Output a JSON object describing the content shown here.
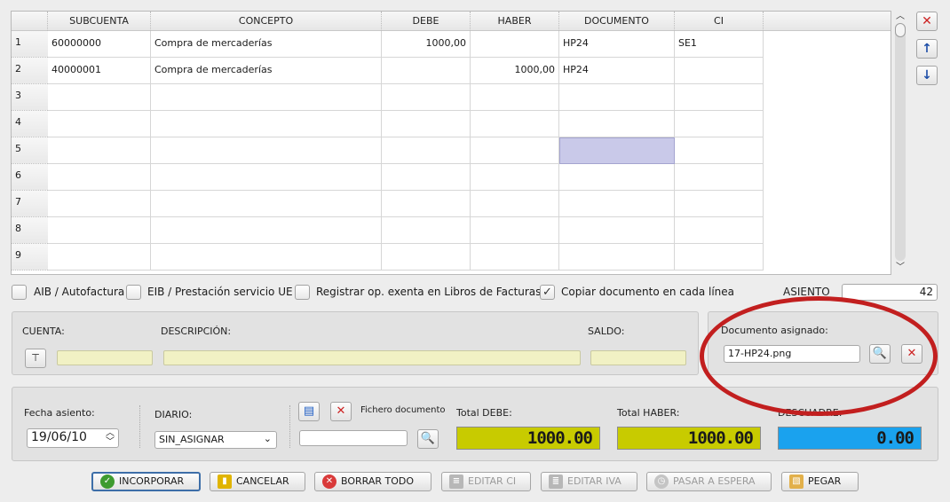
{
  "grid": {
    "columns": [
      "SUBCUENTA",
      "CONCEPTO",
      "DEBE",
      "HABER",
      "DOCUMENTO",
      "CI"
    ],
    "rows": [
      {
        "num": "1",
        "subcuenta": "60000000",
        "concepto": "Compra de mercaderías",
        "debe": "1000,00",
        "haber": "",
        "documento": "HP24",
        "ci": "SE1"
      },
      {
        "num": "2",
        "subcuenta": "40000001",
        "concepto": "Compra de mercaderías",
        "debe": "",
        "haber": "1000,00",
        "documento": "HP24",
        "ci": ""
      },
      {
        "num": "3",
        "subcuenta": "",
        "concepto": "",
        "debe": "",
        "haber": "",
        "documento": "",
        "ci": ""
      },
      {
        "num": "4",
        "subcuenta": "",
        "concepto": "",
        "debe": "",
        "haber": "",
        "documento": "",
        "ci": ""
      },
      {
        "num": "5",
        "subcuenta": "",
        "concepto": "",
        "debe": "",
        "haber": "",
        "documento": "",
        "ci": ""
      },
      {
        "num": "6",
        "subcuenta": "",
        "concepto": "",
        "debe": "",
        "haber": "",
        "documento": "",
        "ci": ""
      },
      {
        "num": "7",
        "subcuenta": "",
        "concepto": "",
        "debe": "",
        "haber": "",
        "documento": "",
        "ci": ""
      },
      {
        "num": "8",
        "subcuenta": "",
        "concepto": "",
        "debe": "",
        "haber": "",
        "documento": "",
        "ci": ""
      },
      {
        "num": "9",
        "subcuenta": "",
        "concepto": "",
        "debe": "",
        "haber": "",
        "documento": "",
        "ci": ""
      }
    ],
    "selected_cell": {
      "row": 5,
      "column": "DOCUMENTO"
    }
  },
  "side_buttons": [
    {
      "name": "delete-row",
      "icon": "close-icon",
      "glyph": "✕",
      "color": "#cc2222"
    },
    {
      "name": "move-up",
      "icon": "arrow-up-icon",
      "glyph": "↑",
      "color": "#1f4fa8"
    },
    {
      "name": "move-down",
      "icon": "arrow-down-icon",
      "glyph": "↓",
      "color": "#1f4fa8"
    }
  ],
  "options": {
    "aib": {
      "label": "AIB / Autofactura",
      "checked": false
    },
    "eib": {
      "label": "EIB / Prestación servicio UE",
      "checked": false
    },
    "exenta": {
      "label": "Registrar op. exenta en Libros de Facturas",
      "checked": false
    },
    "copiar": {
      "label": "Copiar documento en cada línea",
      "checked": true
    }
  },
  "asiento": {
    "label": "ASIENTO",
    "value": "42"
  },
  "account": {
    "cuenta_label": "CUENTA:",
    "descripcion_label": "DESCRIPCIÓN:",
    "saldo_label": "SALDO:"
  },
  "documento": {
    "label": "Documento asignado:",
    "value": "17-HP24.png"
  },
  "footer": {
    "fecha_label": "Fecha asiento:",
    "fecha_value": "19/06/10",
    "diario_label": "DIARIO:",
    "diario_value": "SIN_ASIGNAR",
    "fichero_label": "Fichero documento",
    "total_debe_label": "Total DEBE:",
    "total_debe_value": "1000.00",
    "total_haber_label": "Total HABER:",
    "total_haber_value": "1000.00",
    "descuadre_label": "DESCUADRE:",
    "descuadre_value": "0.00"
  },
  "colors": {
    "lcd_ok": "#c8cb00",
    "lcd_descuadre": "#1aa2ee",
    "highlight_ellipse": "#c21f1f"
  },
  "buttons": {
    "incorporar": "INCORPORAR",
    "cancelar": "CANCELAR",
    "borrar": "BORRAR TODO",
    "editar_ci": "EDITAR CI",
    "editar_iva": "EDITAR IVA",
    "pasar": "PASAR A ESPERA",
    "pegar": "PEGAR"
  }
}
